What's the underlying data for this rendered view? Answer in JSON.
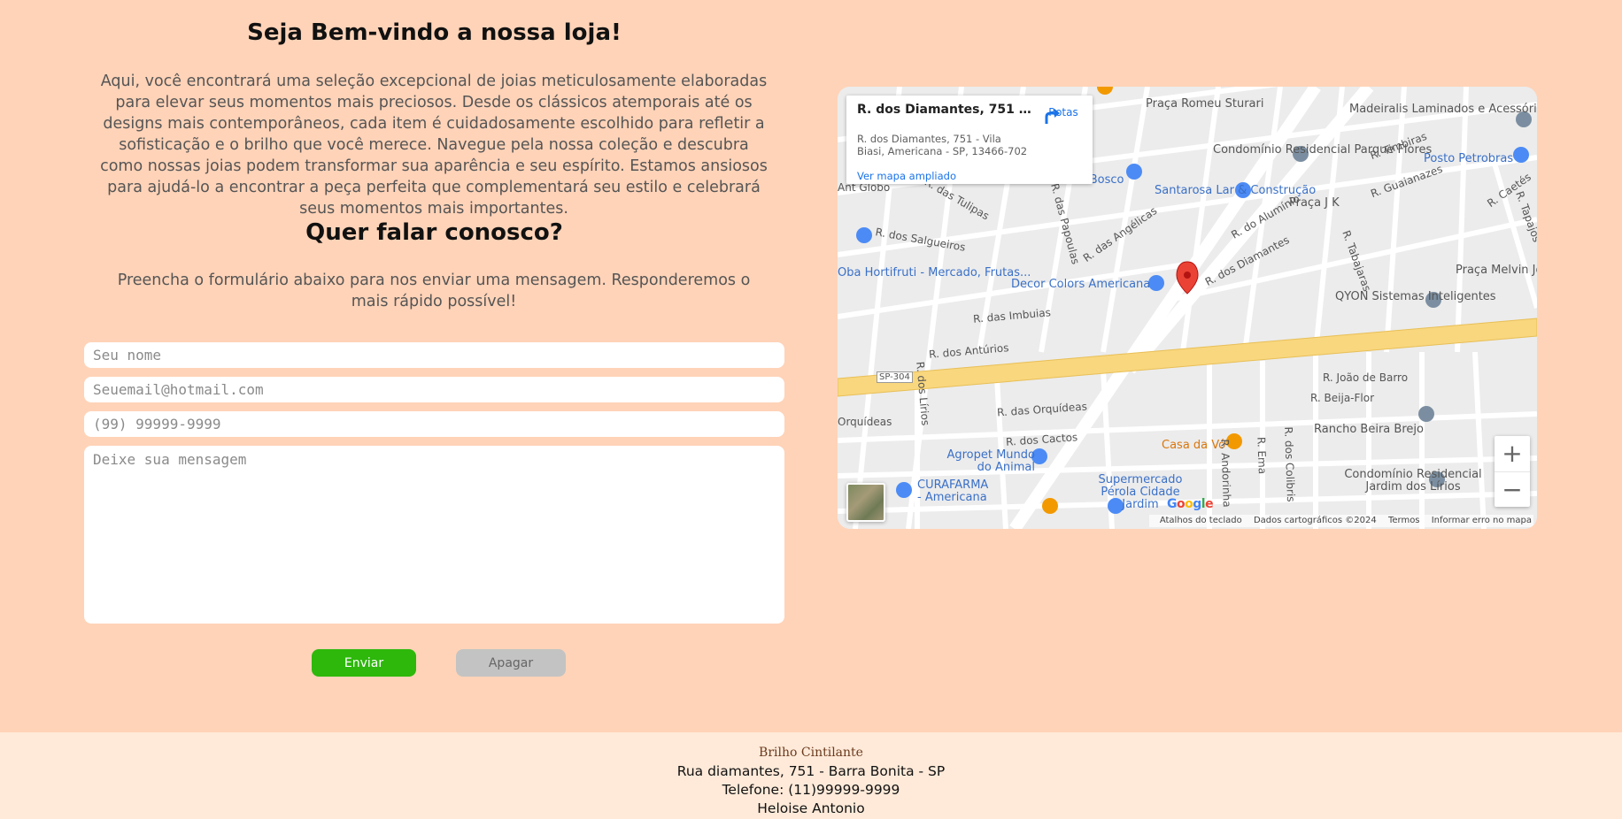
{
  "page": {
    "title": "Seja Bem-vindo a nossa loja!",
    "intro": "Aqui, você encontrará uma seleção excepcional de joias meticulosamente elaboradas para elevar seus momentos mais preciosos. Desde os clássicos atemporais até os designs mais contemporâneos, cada item é cuidadosamente escolhido para refletir a sofisticação e o brilho que você merece. Navegue pela nossa coleção e descubra como nossas joias podem transformar sua aparência e seu espírito. Estamos ansiosos para ajudá-lo a encontrar a peça perfeita que complementará seu estilo e celebrará seus momentos mais importantes.",
    "contact_title": "Quer falar conosco?",
    "contact_text": "Preencha o formulário abaixo para nos enviar uma mensagem. Responderemos o mais rápido possível!"
  },
  "form": {
    "name_placeholder": "Seu nome",
    "email_placeholder": "Seuemail@hotmail.com",
    "phone_placeholder": "(99) 99999-9999",
    "message_placeholder": "Deixe sua mensagem",
    "send_label": "Enviar",
    "clear_label": "Apagar",
    "send_color": "#2db80b",
    "clear_color": "#c3c3c3"
  },
  "map": {
    "card_title": "R. dos Diamantes, 751 - Vila B...",
    "card_address": "R. dos Diamantes, 751 - Vila Biasi, Americana - SP, 13466-702",
    "card_link": "Ver mapa ampliado",
    "directions_label": "Rotas",
    "zoom_in": "+",
    "zoom_out": "−",
    "google": "Google",
    "attribution": {
      "shortcuts": "Atalhos do teclado",
      "data": "Dados cartográficos ©2024",
      "terms": "Termos",
      "report": "Informar erro no mapa"
    },
    "labels": [
      "Praça Romeu Sturari",
      "Madeiralis Laminados e Acessórios para Móveis",
      "Condomínio Residencial Parque Flores",
      "Posto Petrobras",
      "R. Timbiras",
      "Dom Bosco",
      "Santarosa Lar & Construção",
      "Praça J K",
      "R. Guaianazes",
      "R. Caetés",
      "R. das Tulipas",
      "R. das Papoulas",
      "R. dos Salgueiros",
      "R. das Angélicas",
      "R. do Alumínio",
      "R. dos Diamantes",
      "Oba Hortifruti - Mercado, Frutas...",
      "Decor Colors Americana",
      "R. Tabajaras",
      "Praça Melvin Jones",
      "QYON Sistemas Inteligentes",
      "R. das Imbuias",
      "R. dos Antúrios",
      "R. João de Barro",
      "R. Beija-Flor",
      "Rancho Beira Brejo",
      "R. das Orquídeas",
      "R. dos Lírios",
      "R. dos Cactos",
      "Casa da Vó",
      "Agropet Mundo do Animal",
      "CURAFARMA - Americana",
      "Supermercado Pérola Cidade Jardim",
      "Condomínio Residencial Jardim dos Lírios",
      "R. Andorinha",
      "R. Ema",
      "R. dos Colibris",
      "SP-304",
      "Ant Globo",
      "R. Tapajós",
      "Orquídeas"
    ]
  },
  "footer": {
    "brand": "Brilho Cintilante",
    "address": "Rua diamantes, 751 - Barra Bonita - SP",
    "phone": "Telefone: (11)99999-9999",
    "author": "Heloise Antonio"
  }
}
